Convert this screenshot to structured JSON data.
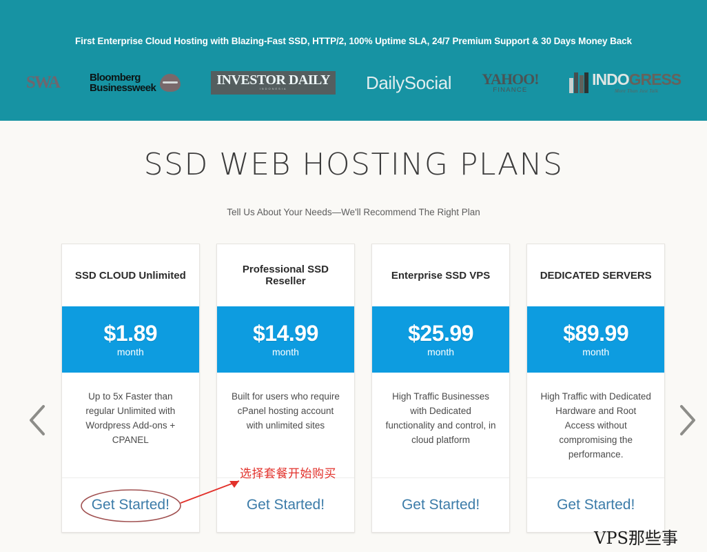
{
  "topbar": {
    "tagline": "First Enterprise Cloud Hosting with Blazing-Fast SSD, HTTP/2, 100% Uptime SLA, 24/7 Premium Support & 30 Days Money Back",
    "background_color": "#1793a3",
    "logos": [
      {
        "name": "swa",
        "text": "SWA"
      },
      {
        "name": "bloomberg-businessweek",
        "line1": "Bloomberg",
        "line2": "Businessweek"
      },
      {
        "name": "investor-daily",
        "text": "INVESTOR DAILY",
        "sub": "INDONESIA"
      },
      {
        "name": "dailysocial",
        "text": "DailySocial"
      },
      {
        "name": "yahoo-finance",
        "text": "YAHOO!",
        "sub": "FINANCE"
      },
      {
        "name": "indogress",
        "part1": "INDO",
        "part2": "GRESS",
        "tagline": "More Than Just Talk"
      }
    ]
  },
  "main": {
    "title": "SSD WEB HOSTING PLANS",
    "subtitle": "Tell Us About Your Needs—We'll Recommend The Right Plan",
    "background_color": "#faf9f6",
    "accent_color": "#0d9ce0",
    "link_color": "#3b7ba8",
    "cta_label": "Get Started!",
    "plans": [
      {
        "title": "SSD CLOUD Unlimited",
        "price": "$1.89",
        "period": "month",
        "description": "Up to 5x Faster than regular Unlimited with Wordpress Add-ons + CPANEL",
        "cta": "Get Started!"
      },
      {
        "title": "Professional SSD Reseller",
        "price": "$14.99",
        "period": "month",
        "description": "Built for users who require cPanel hosting account with unlimited sites",
        "cta": "Get Started!"
      },
      {
        "title": "Enterprise SSD VPS",
        "price": "$25.99",
        "period": "month",
        "description": "High Traffic Businesses with Dedicated functionality and control, in cloud platform",
        "cta": "Get Started!"
      },
      {
        "title": "DEDICATED SERVERS",
        "price": "$89.99",
        "period": "month",
        "description": "High Traffic with Dedicated Hardware and Root Access without compromising the performance.",
        "cta": "Get Started!"
      }
    ]
  },
  "carousel": {
    "prev_icon": "chevron-left-icon",
    "next_icon": "chevron-right-icon"
  },
  "annotation": {
    "text": "选择套餐开始购买",
    "color": "#e2312b"
  },
  "watermark": {
    "text": "VPS那些事"
  }
}
